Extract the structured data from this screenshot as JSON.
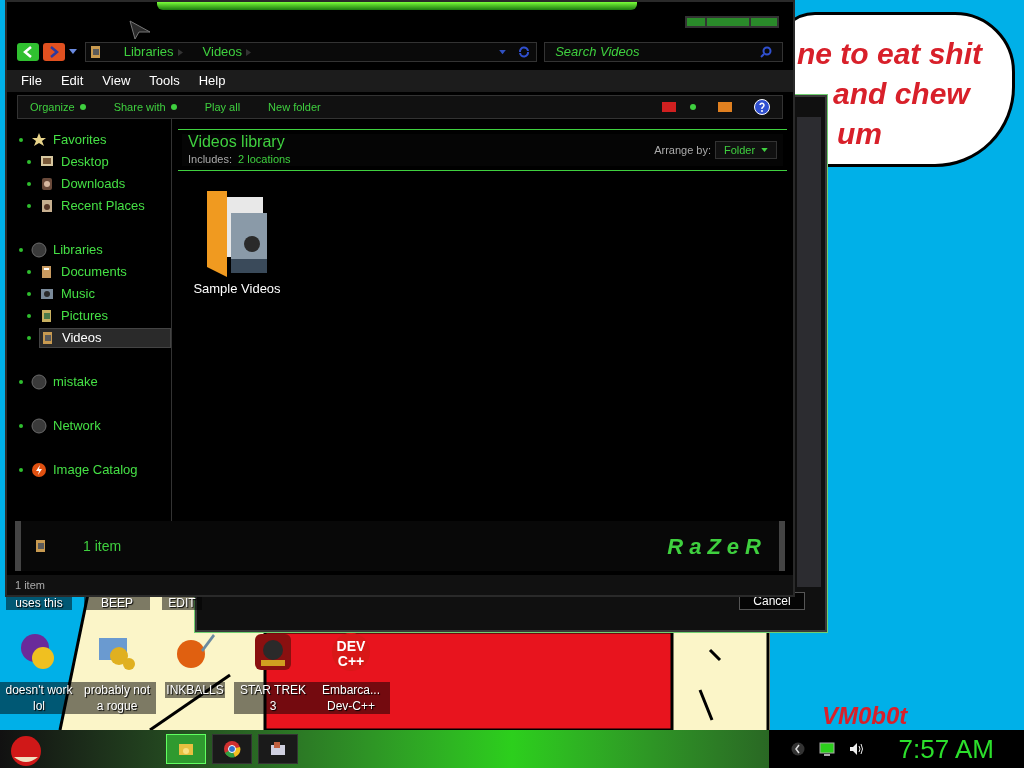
{
  "explorer": {
    "address": [
      "Libraries",
      "Videos"
    ],
    "search": {
      "placeholder": "Search Videos"
    },
    "menu": [
      "File",
      "Edit",
      "View",
      "Tools",
      "Help"
    ],
    "toolbar": [
      {
        "label": "Organize",
        "dropdown": true
      },
      {
        "label": "Share with",
        "dropdown": true
      },
      {
        "label": "Play all",
        "dropdown": false
      },
      {
        "label": "New folder",
        "dropdown": false
      }
    ],
    "sidebar": [
      {
        "label": "Favorites",
        "kind": "star",
        "selected": false,
        "children": [
          {
            "label": "Desktop",
            "kind": "desktop",
            "selected": false
          },
          {
            "label": "Downloads",
            "kind": "download",
            "selected": false
          },
          {
            "label": "Recent Places",
            "kind": "recent",
            "selected": false
          }
        ]
      },
      {
        "label": "Libraries",
        "kind": "orb",
        "selected": false,
        "children": [
          {
            "label": "Documents",
            "kind": "document",
            "selected": false
          },
          {
            "label": "Music",
            "kind": "music",
            "selected": false
          },
          {
            "label": "Pictures",
            "kind": "picture",
            "selected": false
          },
          {
            "label": "Videos",
            "kind": "video",
            "selected": true
          }
        ]
      },
      {
        "label": "mistake",
        "kind": "orb",
        "selected": false
      },
      {
        "label": "Network",
        "kind": "orb",
        "selected": false
      },
      {
        "label": "Image Catalog",
        "kind": "flash",
        "selected": false
      }
    ],
    "library": {
      "title": "Videos library",
      "includes_label": "Includes:",
      "includes_link": "2 locations",
      "arrange_label": "Arrange by:",
      "arrange_value": "Folder"
    },
    "items": [
      {
        "name": "Sample Videos"
      }
    ],
    "details": {
      "count": "1 item",
      "logo": "RaZeR"
    },
    "status_bar": "1 item"
  },
  "dialog": {
    "button": "Cancel"
  },
  "desktop": {
    "bubble": [
      "ne to eat shit",
      "and chew",
      "um"
    ],
    "top_labels": [
      "uses this",
      "BEEP",
      "EDIT"
    ],
    "icons": [
      {
        "label": "doesn't work lol",
        "kind": "messenger"
      },
      {
        "label": "probably not a rogue",
        "kind": "gears"
      },
      {
        "label": "INKBALLS",
        "kind": "ball"
      },
      {
        "label": "STAR TREK 3",
        "kind": "game"
      },
      {
        "label": "Embarca... Dev-C++",
        "kind": "devcpp",
        "icon_text": [
          "DEV",
          "C++"
        ]
      }
    ],
    "signature": "VM0b0t"
  },
  "taskbar": {
    "apps": [
      {
        "kind": "folder",
        "selected": true
      },
      {
        "kind": "browser",
        "selected": false
      },
      {
        "kind": "app",
        "selected": false
      }
    ],
    "clock": "7:57 AM"
  }
}
